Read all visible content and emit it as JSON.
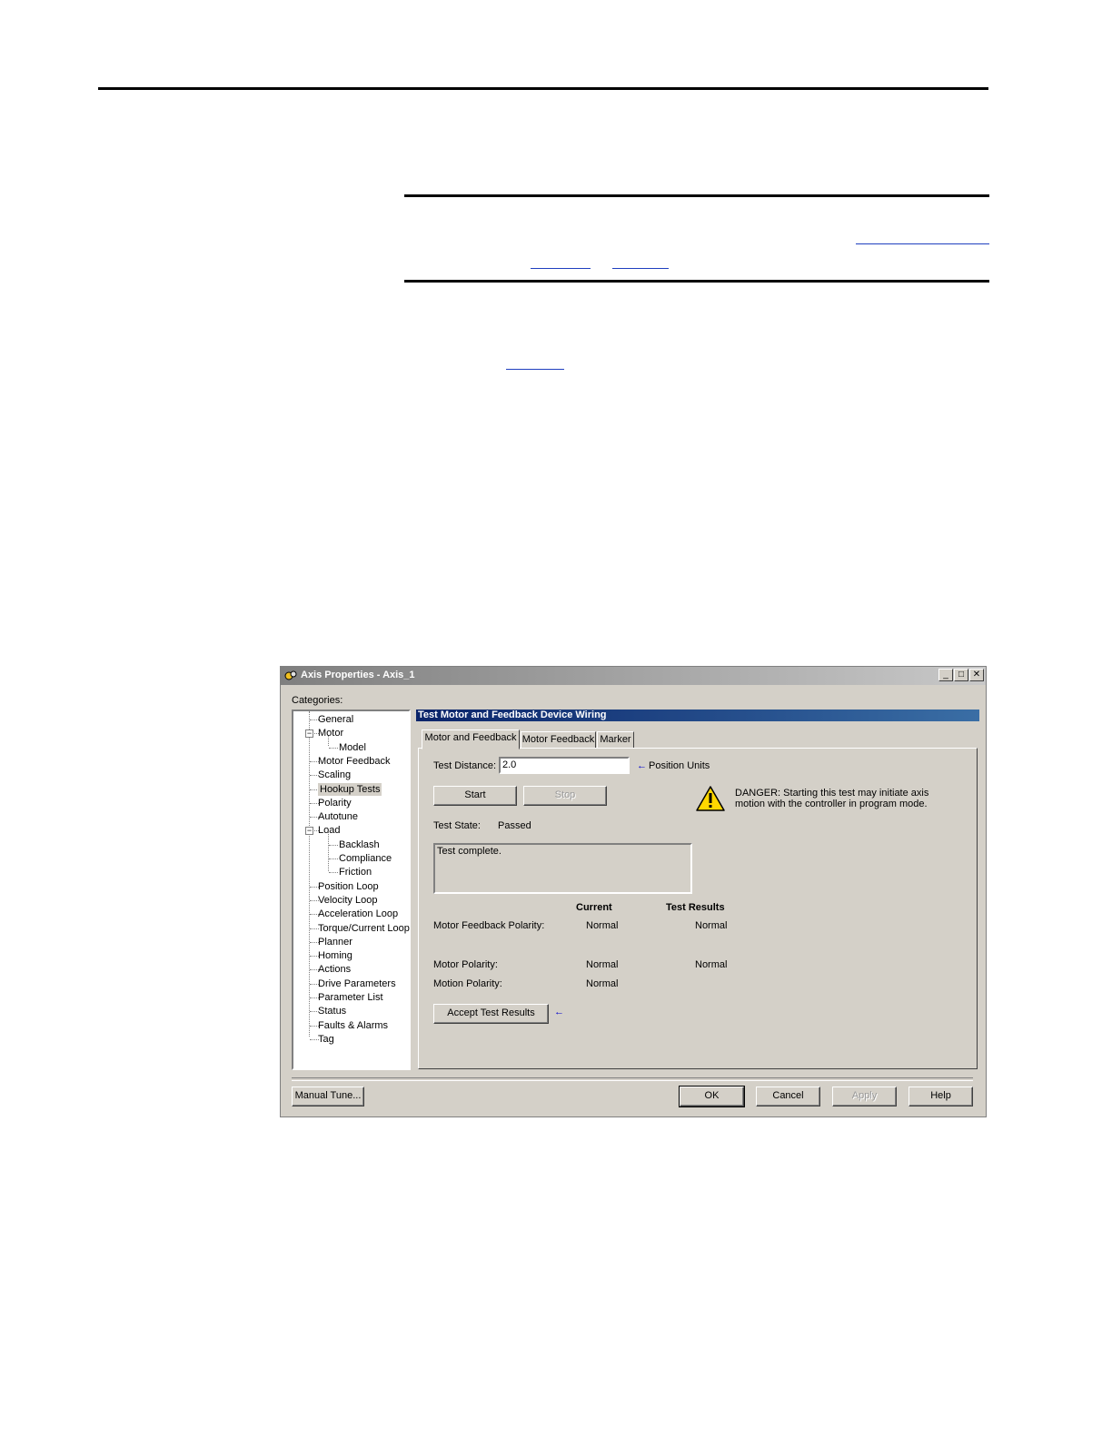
{
  "window": {
    "title": "Axis Properties - Axis_1",
    "controls": {
      "minimize": "_",
      "maximize": "□",
      "close": "✕"
    }
  },
  "categories_label": "Categories:",
  "tree": {
    "items": [
      {
        "label": "General"
      },
      {
        "label": "Motor",
        "expander": "−"
      },
      {
        "label": "Model"
      },
      {
        "label": "Motor Feedback"
      },
      {
        "label": "Scaling"
      },
      {
        "label": "Hookup Tests",
        "selected": true
      },
      {
        "label": "Polarity"
      },
      {
        "label": "Autotune"
      },
      {
        "label": "Load",
        "expander": "−"
      },
      {
        "label": "Backlash"
      },
      {
        "label": "Compliance"
      },
      {
        "label": "Friction"
      },
      {
        "label": "Position Loop"
      },
      {
        "label": "Velocity Loop"
      },
      {
        "label": "Acceleration Loop"
      },
      {
        "label": "Torque/Current Loop"
      },
      {
        "label": "Planner"
      },
      {
        "label": "Homing"
      },
      {
        "label": "Actions"
      },
      {
        "label": "Drive Parameters"
      },
      {
        "label": "Parameter List"
      },
      {
        "label": "Status"
      },
      {
        "label": "Faults & Alarms"
      },
      {
        "label": "Tag"
      }
    ]
  },
  "panel": {
    "header": "Test Motor and Feedback Device Wiring",
    "tabs": [
      {
        "label": "Motor and Feedback",
        "active": true
      },
      {
        "label": "Motor Feedback"
      },
      {
        "label": "Marker"
      }
    ],
    "test_distance_label": "Test Distance:",
    "test_distance_value": "2.0",
    "position_units_label": "Position Units",
    "start_label": "Start",
    "stop_label": "Stop",
    "danger_text_line1": "DANGER: Starting this test may initiate axis",
    "danger_text_line2": "motion with the controller in program mode.",
    "test_state_label": "Test State:",
    "test_state_value": "Passed",
    "message": "Test complete.",
    "col_current": "Current",
    "col_results": "Test Results",
    "rows": [
      {
        "label": "Motor Feedback Polarity:",
        "current": "Normal",
        "result": "Normal"
      },
      {
        "label": "Motor Polarity:",
        "current": "Normal",
        "result": "Normal"
      },
      {
        "label": "Motion Polarity:",
        "current": "Normal",
        "result": ""
      }
    ],
    "accept_label": "Accept Test Results"
  },
  "footer": {
    "manual_tune": "Manual Tune...",
    "ok": "OK",
    "cancel": "Cancel",
    "apply": "Apply",
    "help": "Help"
  },
  "colors": {
    "dialog_bg": "#d4d0c8",
    "header_start": "#0a246a",
    "header_end": "#3a6ea5",
    "arrow": "#0000cc"
  }
}
